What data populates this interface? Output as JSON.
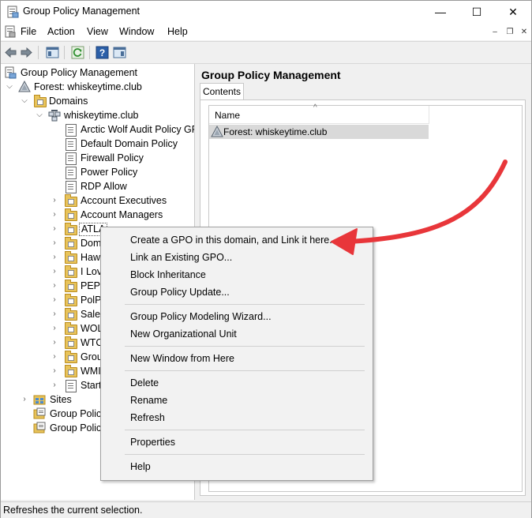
{
  "window": {
    "title": "Group Policy Management",
    "minimize_glyph": "—",
    "maximize_glyph": "☐",
    "close_glyph": "✕"
  },
  "menubar": {
    "items": [
      "File",
      "Action",
      "View",
      "Window",
      "Help"
    ],
    "mdi_minimize": "–",
    "mdi_restore": "❐",
    "mdi_close": "✕"
  },
  "tree": {
    "root": "Group Policy Management",
    "forest": "Forest: whiskeytime.club",
    "domains": "Domains",
    "domain": "whiskeytime.club",
    "gpo_links": [
      "Arctic Wolf Audit Policy GPO",
      "Default Domain Policy",
      "Firewall Policy",
      "Power Policy",
      "RDP Allow"
    ],
    "ous": [
      "Account Executives",
      "Account Managers",
      "ATLA",
      "Dom",
      "Hawl",
      "I Lov",
      "PEP",
      "PolPa",
      "Sales",
      "WOL",
      "WTC_",
      "Grou",
      "WMI",
      "Starte"
    ],
    "sites": "Sites",
    "modeling": "Group Policy",
    "results": "Group Policy"
  },
  "right_pane": {
    "title": "Group Policy Management",
    "tab": "Contents",
    "column_name": "Name",
    "sort_glyph": "^",
    "row": "Forest: whiskeytime.club"
  },
  "context_menu": {
    "group1": [
      "Create a GPO in this domain, and Link it here...",
      "Link an Existing GPO...",
      "Block Inheritance",
      "Group Policy Update..."
    ],
    "group2": [
      "Group Policy Modeling Wizard...",
      "New Organizational Unit"
    ],
    "group3": [
      "New Window from Here"
    ],
    "group4": [
      "Delete",
      "Rename",
      "Refresh"
    ],
    "group5": [
      "Properties"
    ],
    "group6": [
      "Help"
    ]
  },
  "status": {
    "text": "Refreshes the current selection."
  },
  "colors": {
    "annotation_arrow": "#e8363a",
    "selection": "#d9d9d9",
    "folder": "#e8c35a"
  }
}
